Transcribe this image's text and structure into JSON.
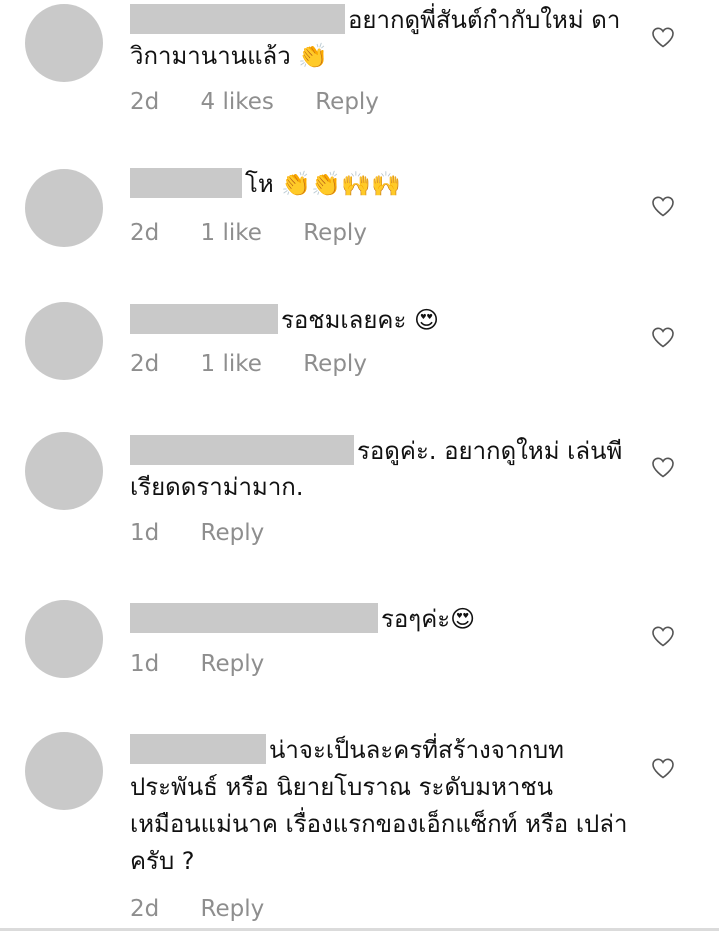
{
  "comments": [
    {
      "text": "อยากดูพี่สันต์กำกับใหม่ ดาวิกามานานแล้ว 👏",
      "time": "2d",
      "likes": "4 likes",
      "reply": "Reply"
    },
    {
      "text": "โห 👏👏🙌🙌",
      "time": "2d",
      "likes": "1 like",
      "reply": "Reply"
    },
    {
      "text": "รอชมเลยคะ 😍",
      "time": "2d",
      "likes": "1 like",
      "reply": "Reply"
    },
    {
      "text": "รอดูค่ะ. อยากดูใหม่ เล่นพีเรียดดราม่ามาก.",
      "time": "1d",
      "likes": "",
      "reply": "Reply"
    },
    {
      "text": "รอๆค่ะ😍",
      "time": "1d",
      "likes": "",
      "reply": "Reply"
    },
    {
      "text": "น่าจะเป็นละครที่สร้างจากบท ประพันธ์ หรือ นิยายโบราณ ระดับมหาชน เหมือนแม่นาค เรื่องแรกของเอ็กแซ็กท์ หรือ เปล่าครับ ?",
      "time": "2d",
      "likes": "",
      "reply": "Reply"
    }
  ],
  "icons": {
    "like": "heart-outline-icon",
    "avatar": "avatar-placeholder"
  },
  "colors": {
    "avatar": "#c9c9c9",
    "meta": "#8e8e8e",
    "text": "#111111"
  }
}
